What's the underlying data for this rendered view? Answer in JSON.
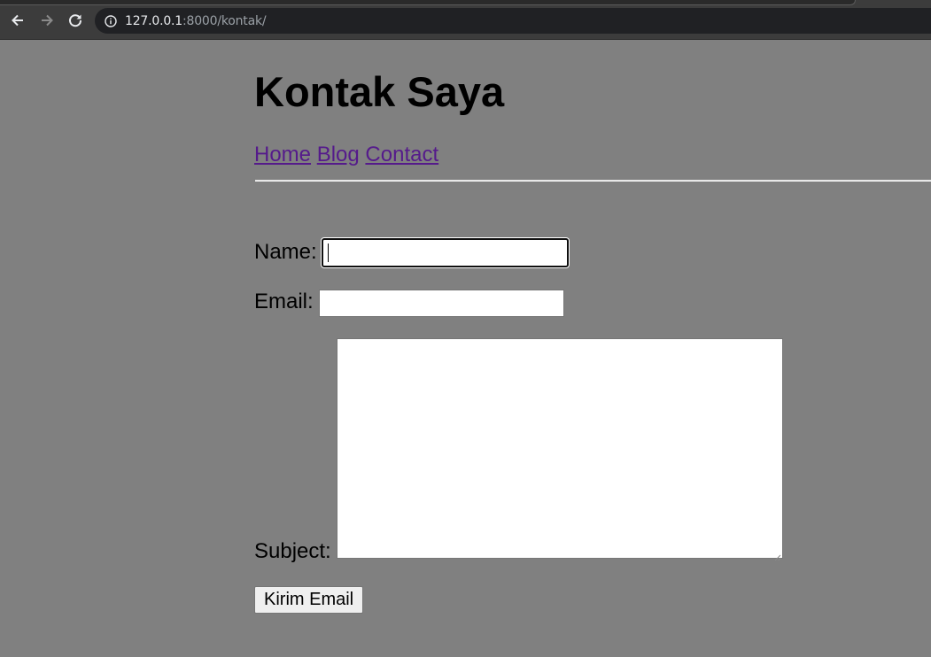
{
  "browser": {
    "url_host": "127.0.0.1",
    "url_rest": ":8000/kontak/"
  },
  "page": {
    "title": "Kontak Saya",
    "nav": [
      {
        "label": "Home"
      },
      {
        "label": "Blog"
      },
      {
        "label": "Contact"
      }
    ]
  },
  "form": {
    "name_label": "Name:",
    "name_value": "",
    "email_label": "Email:",
    "email_value": "",
    "subject_label": "Subject:",
    "subject_value": "",
    "submit_label": "Kirim Email"
  },
  "colors": {
    "page_background": "#808080",
    "link": "#551a8b"
  }
}
